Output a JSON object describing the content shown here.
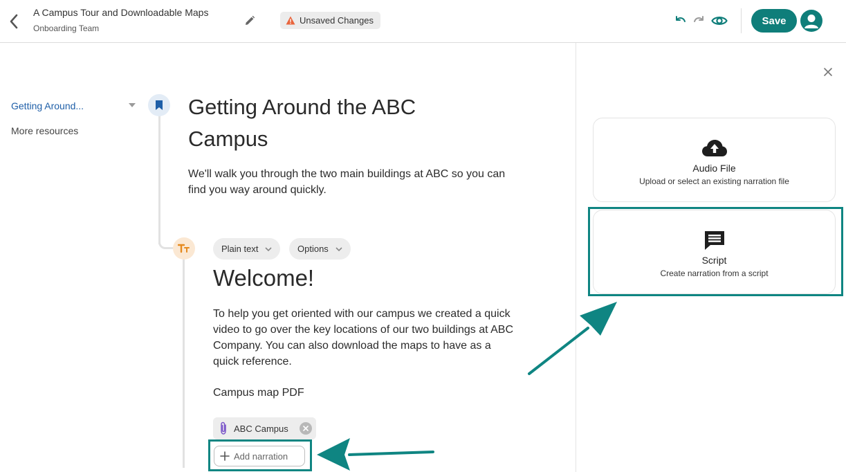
{
  "header": {
    "title": "A Campus Tour and Downloadable Maps",
    "subtitle": "Onboarding Team",
    "status_badge": "Unsaved Changes",
    "save_label": "Save"
  },
  "nav": {
    "items": [
      {
        "label": "Getting Around...",
        "active": true
      },
      {
        "label": "More resources",
        "active": false
      }
    ]
  },
  "section": {
    "title": "Getting Around the ABC Campus",
    "description": "We'll walk you through the two main buildings at ABC so you can find you way around quickly."
  },
  "block": {
    "format_chip": "Plain text",
    "options_chip": "Options",
    "heading": "Welcome!",
    "body": "To help you get oriented with our campus we created a quick video to go over the key locations of our two buildings at ABC Company. You can also download the maps to have as a quick reference.",
    "map_label": "Campus map PDF",
    "attachment_name": "ABC Campus",
    "add_narration_label": "Add narration"
  },
  "panel": {
    "cards": [
      {
        "title": "Audio File",
        "description": "Upload or select an existing narration file",
        "icon": "cloud-upload-icon"
      },
      {
        "title": "Script",
        "description": "Create narration from a script",
        "icon": "comment-icon"
      }
    ]
  },
  "colors": {
    "accent": "#0f7e7a",
    "link": "#1f5fa8",
    "warning": "#e8643c",
    "highlight": "#0f8582"
  }
}
